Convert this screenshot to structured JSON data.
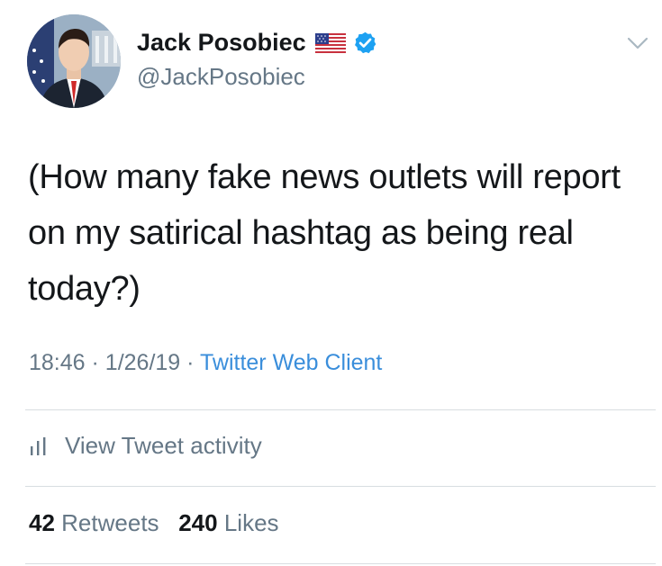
{
  "tweet": {
    "author": {
      "display_name": "Jack Posobiec",
      "handle": "@JackPosobiec",
      "badges": [
        "flag-us-icon",
        "verified-icon"
      ]
    },
    "text": "(How many fake news outlets will report on my satirical hashtag as being real today?)",
    "time": "18:46",
    "separator": "·",
    "date": "1/26/19",
    "source": "Twitter Web Client",
    "activity_label": "View Tweet activity",
    "stats": {
      "retweets_count": "42",
      "retweets_label": "Retweets",
      "likes_count": "240",
      "likes_label": "Likes"
    }
  },
  "colors": {
    "text_primary": "#14171a",
    "text_secondary": "#657786",
    "link": "#3a8edb",
    "verified": "#1da1f2",
    "divider": "#d8dde1"
  }
}
